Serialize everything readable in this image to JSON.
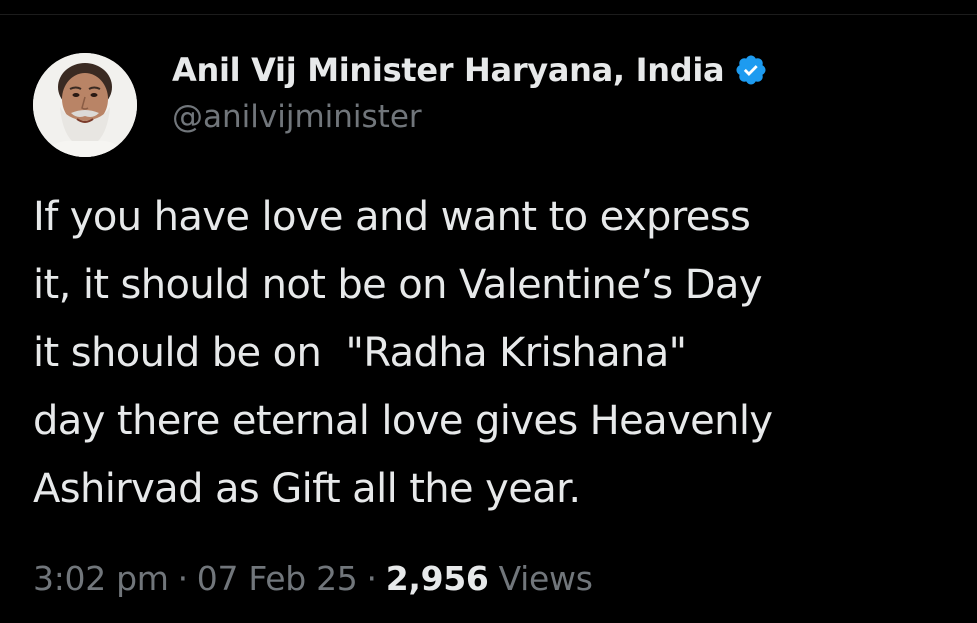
{
  "tweet": {
    "author": {
      "display_name": "Anil Vij Minister Haryana, India",
      "handle": "@anilvijminister",
      "verified": true,
      "verified_badge_color": "#1d9bf0"
    },
    "text_lines": [
      "If you have love and want to express",
      "it, it should not be on Valentine’s Day",
      "it should be on  \"Radha Krishana\"",
      "day there eternal love gives Heavenly",
      "Ashirvad as Gift all the year."
    ],
    "meta": {
      "time": "3:02 pm",
      "separator": "·",
      "date": "07 Feb 25",
      "views_count": "2,956",
      "views_label": "Views"
    }
  },
  "colors": {
    "background": "#000000",
    "primary_text": "#e7e9ea",
    "secondary_text": "#71767b"
  }
}
